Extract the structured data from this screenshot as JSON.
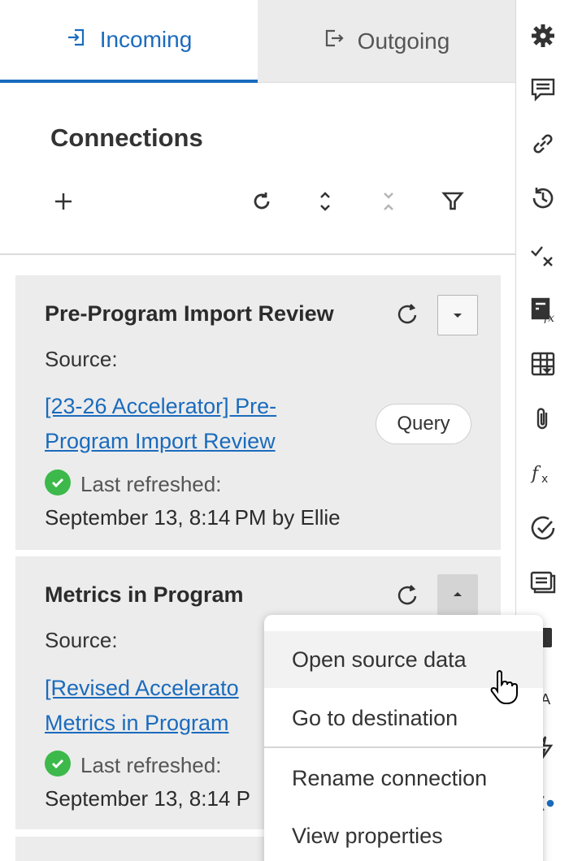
{
  "tabs": {
    "incoming": "Incoming",
    "outgoing": "Outgoing"
  },
  "section": {
    "title": "Connections"
  },
  "toolbar": {
    "add_icon": "plus-icon",
    "refresh_icon": "refresh-icon",
    "expand_icon": "expand-icon",
    "collapse_icon": "collapse-icon",
    "filter_icon": "filter-icon"
  },
  "cards": [
    {
      "title": "Pre-Program Import Review",
      "source_label": "Source:",
      "link_line1": "[23-26 Accelerator] Pre-",
      "link_line2": "Program Import Review",
      "badge": "Query",
      "refresh_label": "Last refreshed:",
      "refresh_date": "September 13, 8:14 PM by Ellie",
      "menu_open": false
    },
    {
      "title": "Metrics in Program",
      "source_label": "Source:",
      "link_line1": "[Revised Accelerato",
      "link_line2": "Metrics in Program",
      "refresh_label": "Last refreshed:",
      "refresh_date": "September 13, 8:14 P",
      "menu_open": true
    }
  ],
  "menu": {
    "items": [
      "Open source data",
      "Go to destination",
      "Rename connection",
      "View properties"
    ],
    "hovered_item": "Open source data"
  },
  "sidebar_icons": [
    "gear-icon",
    "comment-icon",
    "link-icon",
    "history-icon",
    "check-x-icon",
    "sheet-formula-icon",
    "grid-dropdown-icon",
    "attachment-icon",
    "fx-icon",
    "check-circle-icon",
    "list-card-icon",
    "form-icon",
    "translate-icon",
    "lightning-icon",
    "connections-icon"
  ],
  "colors": {
    "accent": "#1a6bbd",
    "success": "#3cb94a",
    "card_bg": "#ececec",
    "tab_inactive_bg": "#ebebeb"
  }
}
